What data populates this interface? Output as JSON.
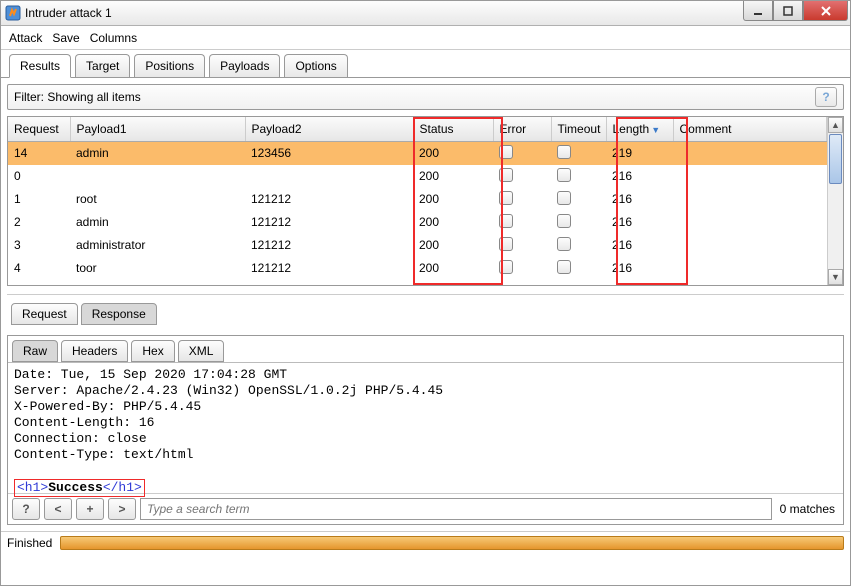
{
  "window": {
    "title": "Intruder attack 1"
  },
  "menu": {
    "attack": "Attack",
    "save": "Save",
    "columns": "Columns"
  },
  "tabs": {
    "results": "Results",
    "target": "Target",
    "positions": "Positions",
    "payloads": "Payloads",
    "options": "Options"
  },
  "filter": {
    "text": "Filter: Showing all items"
  },
  "columns": {
    "request": "Request",
    "payload1": "Payload1",
    "payload2": "Payload2",
    "status": "Status",
    "error": "Error",
    "timeout": "Timeout",
    "length": "Length",
    "comment": "Comment"
  },
  "rows": [
    {
      "req": "14",
      "p1": "admin",
      "p2": "123456",
      "status": "200",
      "len": "219"
    },
    {
      "req": "0",
      "p1": "",
      "p2": "",
      "status": "200",
      "len": "216"
    },
    {
      "req": "1",
      "p1": "root",
      "p2": "121212",
      "status": "200",
      "len": "216"
    },
    {
      "req": "2",
      "p1": "admin",
      "p2": "121212",
      "status": "200",
      "len": "216"
    },
    {
      "req": "3",
      "p1": "administrator",
      "p2": "121212",
      "status": "200",
      "len": "216"
    },
    {
      "req": "4",
      "p1": "toor",
      "p2": "121212",
      "status": "200",
      "len": "216"
    }
  ],
  "lower_tabs": {
    "request": "Request",
    "response": "Response"
  },
  "viewer_tabs": {
    "raw": "Raw",
    "headers": "Headers",
    "hex": "Hex",
    "xml": "XML"
  },
  "response": {
    "line1": "Date: Tue, 15 Sep 2020 17:04:28 GMT",
    "line2": "Server: Apache/2.4.23 (Win32) OpenSSL/1.0.2j PHP/5.4.45",
    "line3": "X-Powered-By: PHP/5.4.45",
    "line4": "Content-Length: 16",
    "line5": "Connection: close",
    "line6": "Content-Type: text/html",
    "body_open": "<h1>",
    "body_text": "Success",
    "body_close": "</h1>"
  },
  "search": {
    "help": "?",
    "prev": "<",
    "plus": "+",
    "next": ">",
    "placeholder": "Type a search term",
    "matches": "0 matches"
  },
  "status": {
    "label": "Finished"
  }
}
